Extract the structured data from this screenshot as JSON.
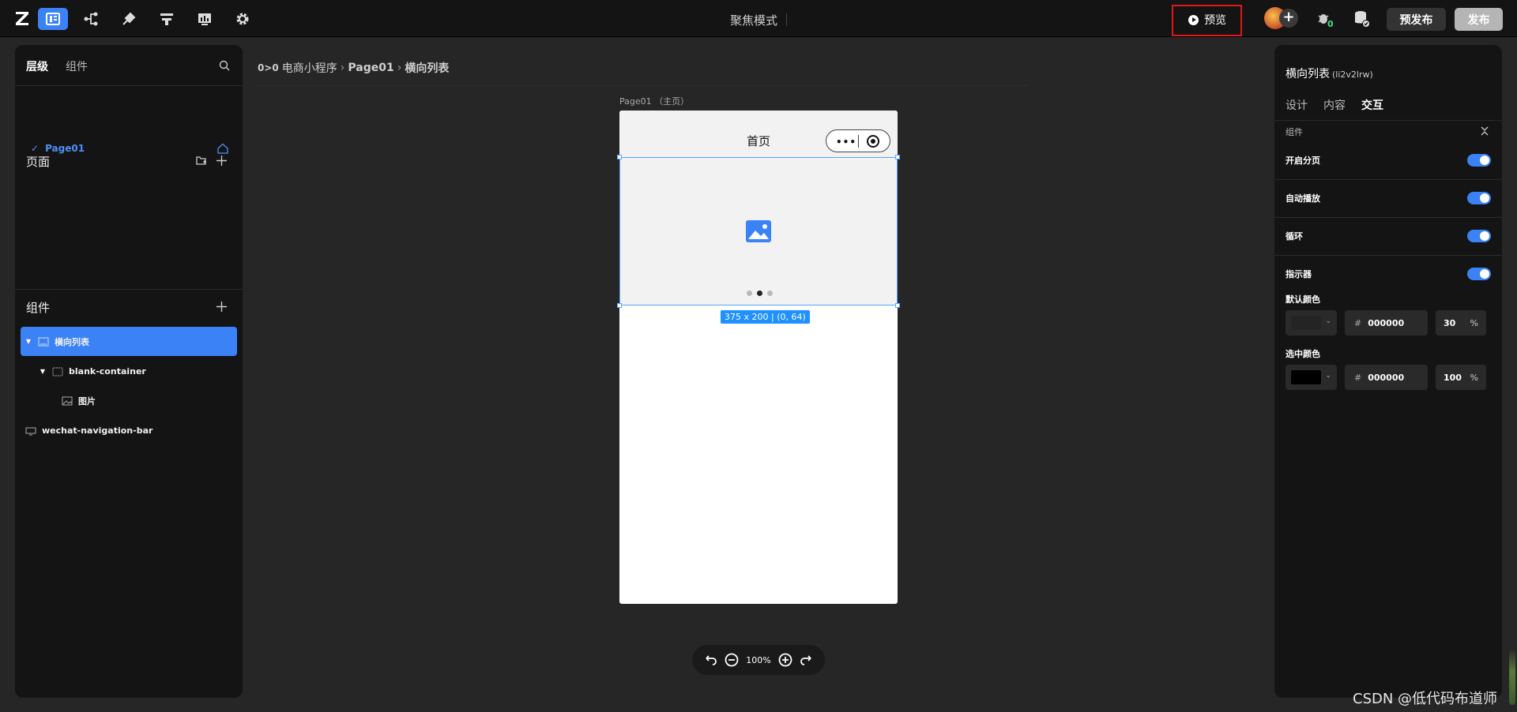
{
  "topbar": {
    "mode_title": "聚焦模式",
    "preview_label": "预览",
    "prepublish_label": "预发布",
    "publish_label": "发布",
    "bug_badge": "0",
    "icons": [
      "pages-icon",
      "flow-icon",
      "plugin-icon",
      "api-icon",
      "dashboard-icon",
      "gear-icon"
    ]
  },
  "left_panel": {
    "tabs": [
      "层级",
      "组件"
    ],
    "pages_title": "页面",
    "page_item": "Page01",
    "components_title": "组件",
    "tree": [
      {
        "label": "横向列表",
        "selected": true
      },
      {
        "label": "blank-container"
      },
      {
        "label": "图片"
      },
      {
        "label": "wechat-navigation-bar"
      }
    ]
  },
  "canvas": {
    "breadcrumb": [
      "电商小程序",
      "Page01",
      "横向列表"
    ],
    "page_label": "Page01 （主页）",
    "nav_title": "首页",
    "size_badge": "375 x 200 | (0, 64)",
    "zoom": "100%"
  },
  "right_panel": {
    "title": "横向列表",
    "component_id": "(li2v2lrw)",
    "tabs": [
      "设计",
      "内容",
      "交互"
    ],
    "section": "组件",
    "toggles": [
      {
        "label": "开启分页",
        "on": true
      },
      {
        "label": "自动播放",
        "on": true
      },
      {
        "label": "循环",
        "on": true
      },
      {
        "label": "指示器",
        "on": true
      }
    ],
    "default_color": {
      "label": "默认颜色",
      "hex": "000000",
      "opacity": "30",
      "unit": "%"
    },
    "selected_color": {
      "label": "选中颜色",
      "hex": "000000",
      "opacity": "100",
      "unit": "%"
    }
  },
  "colors": {
    "accent": "#3b82f6",
    "highlight": "#e01818",
    "selection": "#56a4ff"
  },
  "watermark": "CSDN @低代码布道师"
}
